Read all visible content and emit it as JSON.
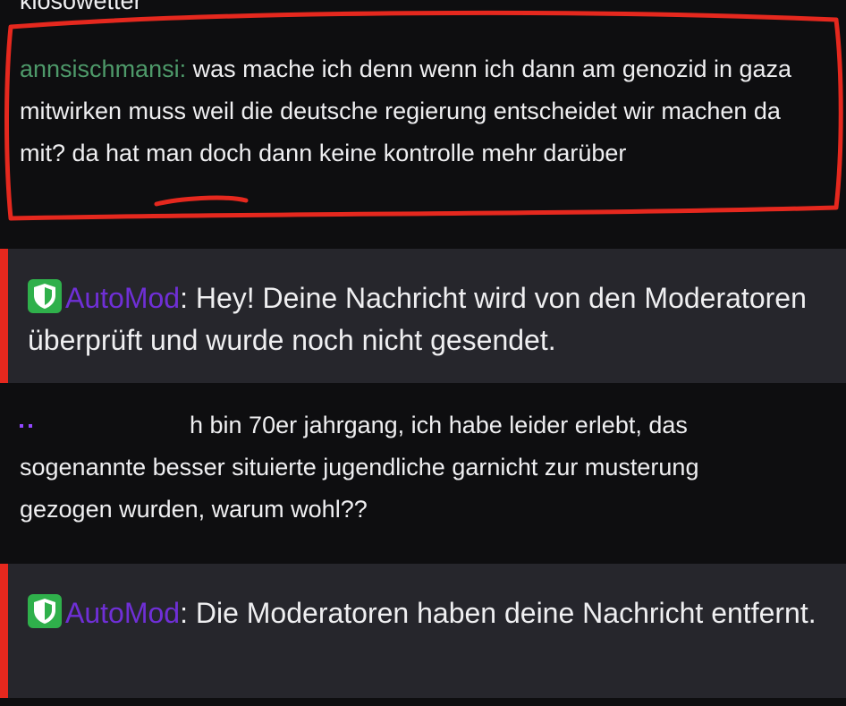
{
  "top_cut_text": "kiosowetter",
  "messages": [
    {
      "username": "annsischmansi",
      "separator": ":",
      "text": "was mache ich denn wenn ich dann am genozid in gaza mitwirken muss weil die deutsche regierung entscheidet wir machen da mit? da hat man doch dann keine kontrolle mehr darüber"
    },
    {
      "username": "AutoMod",
      "separator": ":",
      "text": "Hey! Deine Nachricht wird von den Moderatoren überprüft und wurde noch nicht gesendet."
    },
    {
      "line1": "h bin 70er jahrgang, ich habe leider erlebt, das",
      "line2": "sogenannte besser situierte jugendliche garnicht zur musterung",
      "line3": "gezogen wurden, warum wohl??"
    },
    {
      "username": "AutoMod",
      "separator": ":",
      "text": "Die Moderatoren haben deine Nachricht entfernt."
    }
  ],
  "colors": {
    "background": "#0e0e10",
    "automod_background": "#26262c",
    "automod_accent": "#e5281e",
    "automod_name": "#6f2fd6",
    "user_name": "#4e9a6a",
    "highlight_circle": "#e5281e",
    "shield": "#2fb04b"
  },
  "icons": [
    "shield-icon"
  ]
}
